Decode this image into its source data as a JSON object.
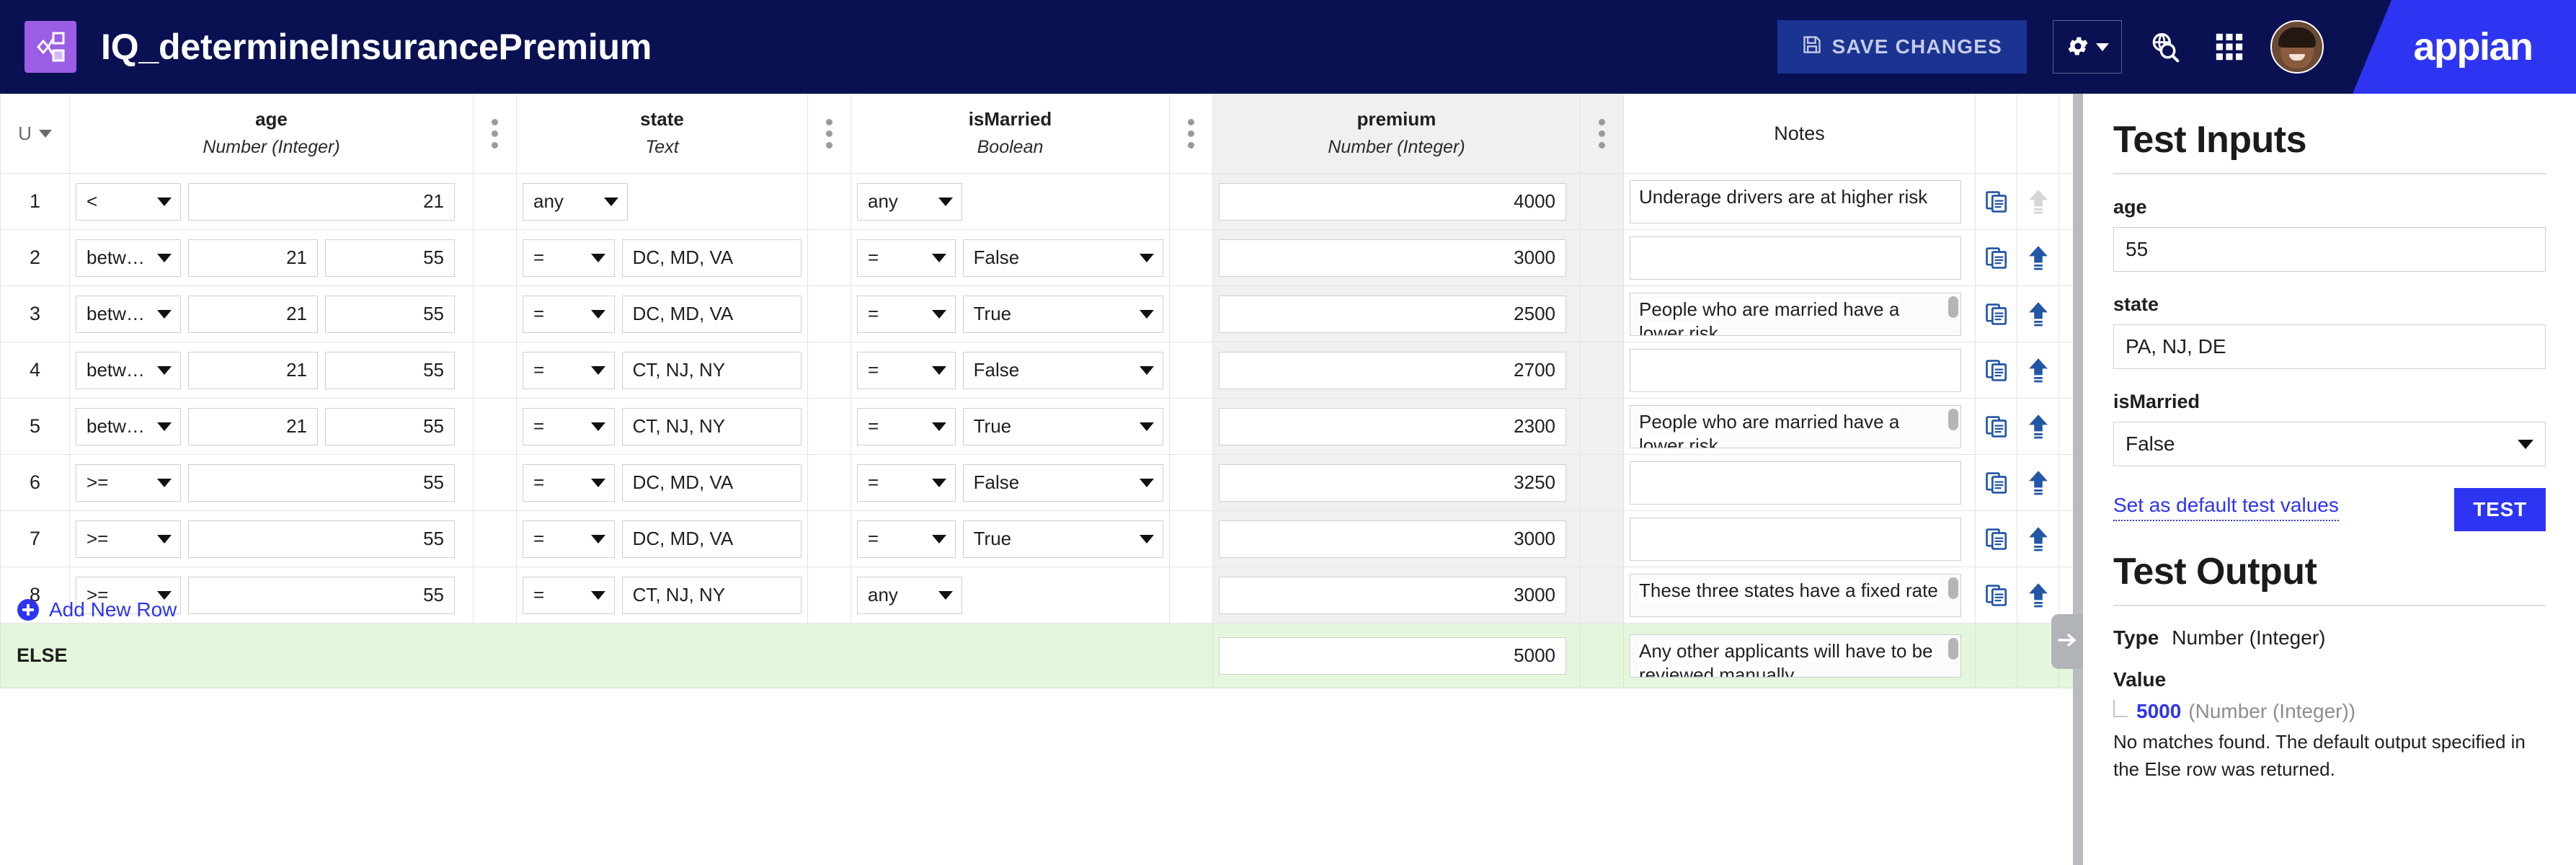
{
  "header": {
    "app_icon_name": "decision-object-icon",
    "title": "IQ_determineInsurancePremium",
    "save_label": "SAVE CHANGES",
    "brand": "appian",
    "icons": {
      "save": "save-disk-icon",
      "gear": "gear-icon",
      "gear_caret": "chevron-down-icon",
      "search": "globe-search-icon",
      "grid": "app-grid-icon",
      "avatar": "user-avatar"
    },
    "colors": {
      "topbar_bg": "#0a1152",
      "app_icon_bg": "#9b5de5",
      "save_bg": "#1b3391",
      "brand_bg": "#2d34f2"
    }
  },
  "table": {
    "row_header_label": "U",
    "columns": [
      {
        "name": "age",
        "type": "Number (Integer)"
      },
      {
        "name": "state",
        "type": "Text"
      },
      {
        "name": "isMarried",
        "type": "Boolean"
      },
      {
        "name": "premium",
        "type": "Number (Integer)"
      }
    ],
    "notes_header": "Notes",
    "else_label": "ELSE",
    "add_row_label": "Add New Row",
    "rows": [
      {
        "num": "1",
        "age_op": "<",
        "age_v1": "21",
        "age_v2": "",
        "state_op": "any",
        "state_val": "",
        "married_op": "any",
        "married_val": "",
        "premium": "4000",
        "notes": "Underage drivers are at higher risk",
        "notes_scroll": false,
        "move_up_enabled": false
      },
      {
        "num": "2",
        "age_op": "betw…",
        "age_v1": "21",
        "age_v2": "55",
        "state_op": "=",
        "state_val": "DC, MD, VA",
        "married_op": "=",
        "married_val": "False",
        "premium": "3000",
        "notes": "",
        "notes_scroll": false,
        "move_up_enabled": true
      },
      {
        "num": "3",
        "age_op": "betw…",
        "age_v1": "21",
        "age_v2": "55",
        "state_op": "=",
        "state_val": "DC, MD, VA",
        "married_op": "=",
        "married_val": "True",
        "premium": "2500",
        "notes": "People who are married have a lower risk",
        "notes_scroll": true,
        "move_up_enabled": true
      },
      {
        "num": "4",
        "age_op": "betw…",
        "age_v1": "21",
        "age_v2": "55",
        "state_op": "=",
        "state_val": "CT, NJ, NY",
        "married_op": "=",
        "married_val": "False",
        "premium": "2700",
        "notes": "",
        "notes_scroll": false,
        "move_up_enabled": true
      },
      {
        "num": "5",
        "age_op": "betw…",
        "age_v1": "21",
        "age_v2": "55",
        "state_op": "=",
        "state_val": "CT, NJ, NY",
        "married_op": "=",
        "married_val": "True",
        "premium": "2300",
        "notes": "People who are married have a lower risk",
        "notes_scroll": true,
        "move_up_enabled": true
      },
      {
        "num": "6",
        "age_op": ">=",
        "age_v1": "55",
        "age_v2": "",
        "state_op": "=",
        "state_val": "DC, MD, VA",
        "married_op": "=",
        "married_val": "False",
        "premium": "3250",
        "notes": "",
        "notes_scroll": false,
        "move_up_enabled": true
      },
      {
        "num": "7",
        "age_op": ">=",
        "age_v1": "55",
        "age_v2": "",
        "state_op": "=",
        "state_val": "DC, MD, VA",
        "married_op": "=",
        "married_val": "True",
        "premium": "3000",
        "notes": "",
        "notes_scroll": false,
        "move_up_enabled": true
      },
      {
        "num": "8",
        "age_op": ">=",
        "age_v1": "55",
        "age_v2": "",
        "state_op": "=",
        "state_val": "CT, NJ, NY",
        "married_op": "any",
        "married_val": "",
        "premium": "3000",
        "notes": "These three states have a fixed rate",
        "notes_scroll": true,
        "move_up_enabled": true
      }
    ],
    "else_row": {
      "premium": "5000",
      "notes": "Any other applicants will have to be reviewed manually",
      "notes_scroll": true
    },
    "icons": {
      "copy": "copy-row-icon",
      "move_up": "arrow-up-icon",
      "kebab": "column-menu-icon",
      "row_header_caret": "chevron-down-icon",
      "add_row": "plus-circle-icon",
      "collapse_panel": "arrow-right-icon"
    }
  },
  "side_panel": {
    "inputs_heading": "Test Inputs",
    "fields": [
      {
        "label": "age",
        "value": "55",
        "kind": "text"
      },
      {
        "label": "state",
        "value": "PA, NJ, DE",
        "kind": "text"
      },
      {
        "label": "isMarried",
        "value": "False",
        "kind": "select"
      }
    ],
    "set_default_link": "Set as default test values",
    "test_button": "TEST",
    "output_heading": "Test Output",
    "type_label": "Type",
    "type_value": "Number (Integer)",
    "value_label": "Value",
    "value_number": "5000",
    "value_type": "(Number (Integer))",
    "message": "No matches found. The default output specified in the Else row was returned."
  }
}
